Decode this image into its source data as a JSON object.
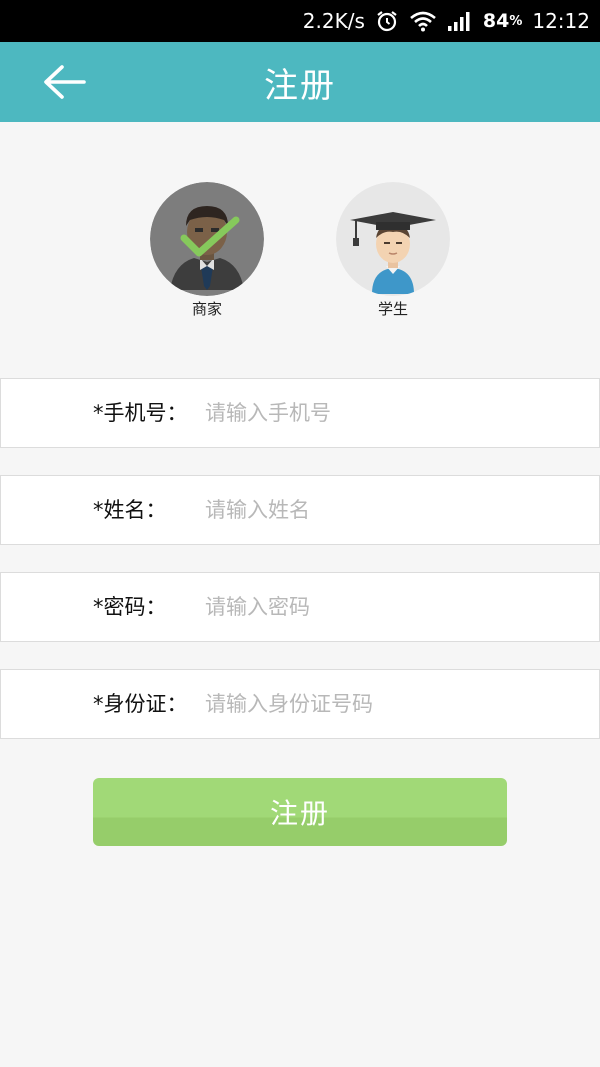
{
  "status_bar": {
    "net_speed": "2.2K/s",
    "battery_value": "84",
    "battery_unit": "%",
    "time": "12:12",
    "icons": [
      "alarm-icon",
      "wifi-icon",
      "signal-icon"
    ]
  },
  "header": {
    "title": "注册",
    "back_icon": "arrow-left-icon",
    "background": "#4db8c0"
  },
  "roles": [
    {
      "label": "商家",
      "selected": true
    },
    {
      "label": "学生",
      "selected": false
    }
  ],
  "form": {
    "fields": [
      {
        "label": "*手机号：",
        "placeholder": "请输入手机号",
        "value": ""
      },
      {
        "label": "*姓名：",
        "placeholder": "请输入姓名",
        "value": ""
      },
      {
        "label": "*密码：",
        "placeholder": "请输入密码",
        "value": ""
      },
      {
        "label": "*身份证：",
        "placeholder": "请输入身份证号码",
        "value": ""
      }
    ]
  },
  "submit": {
    "label": "注册",
    "color": "#9ed474"
  }
}
